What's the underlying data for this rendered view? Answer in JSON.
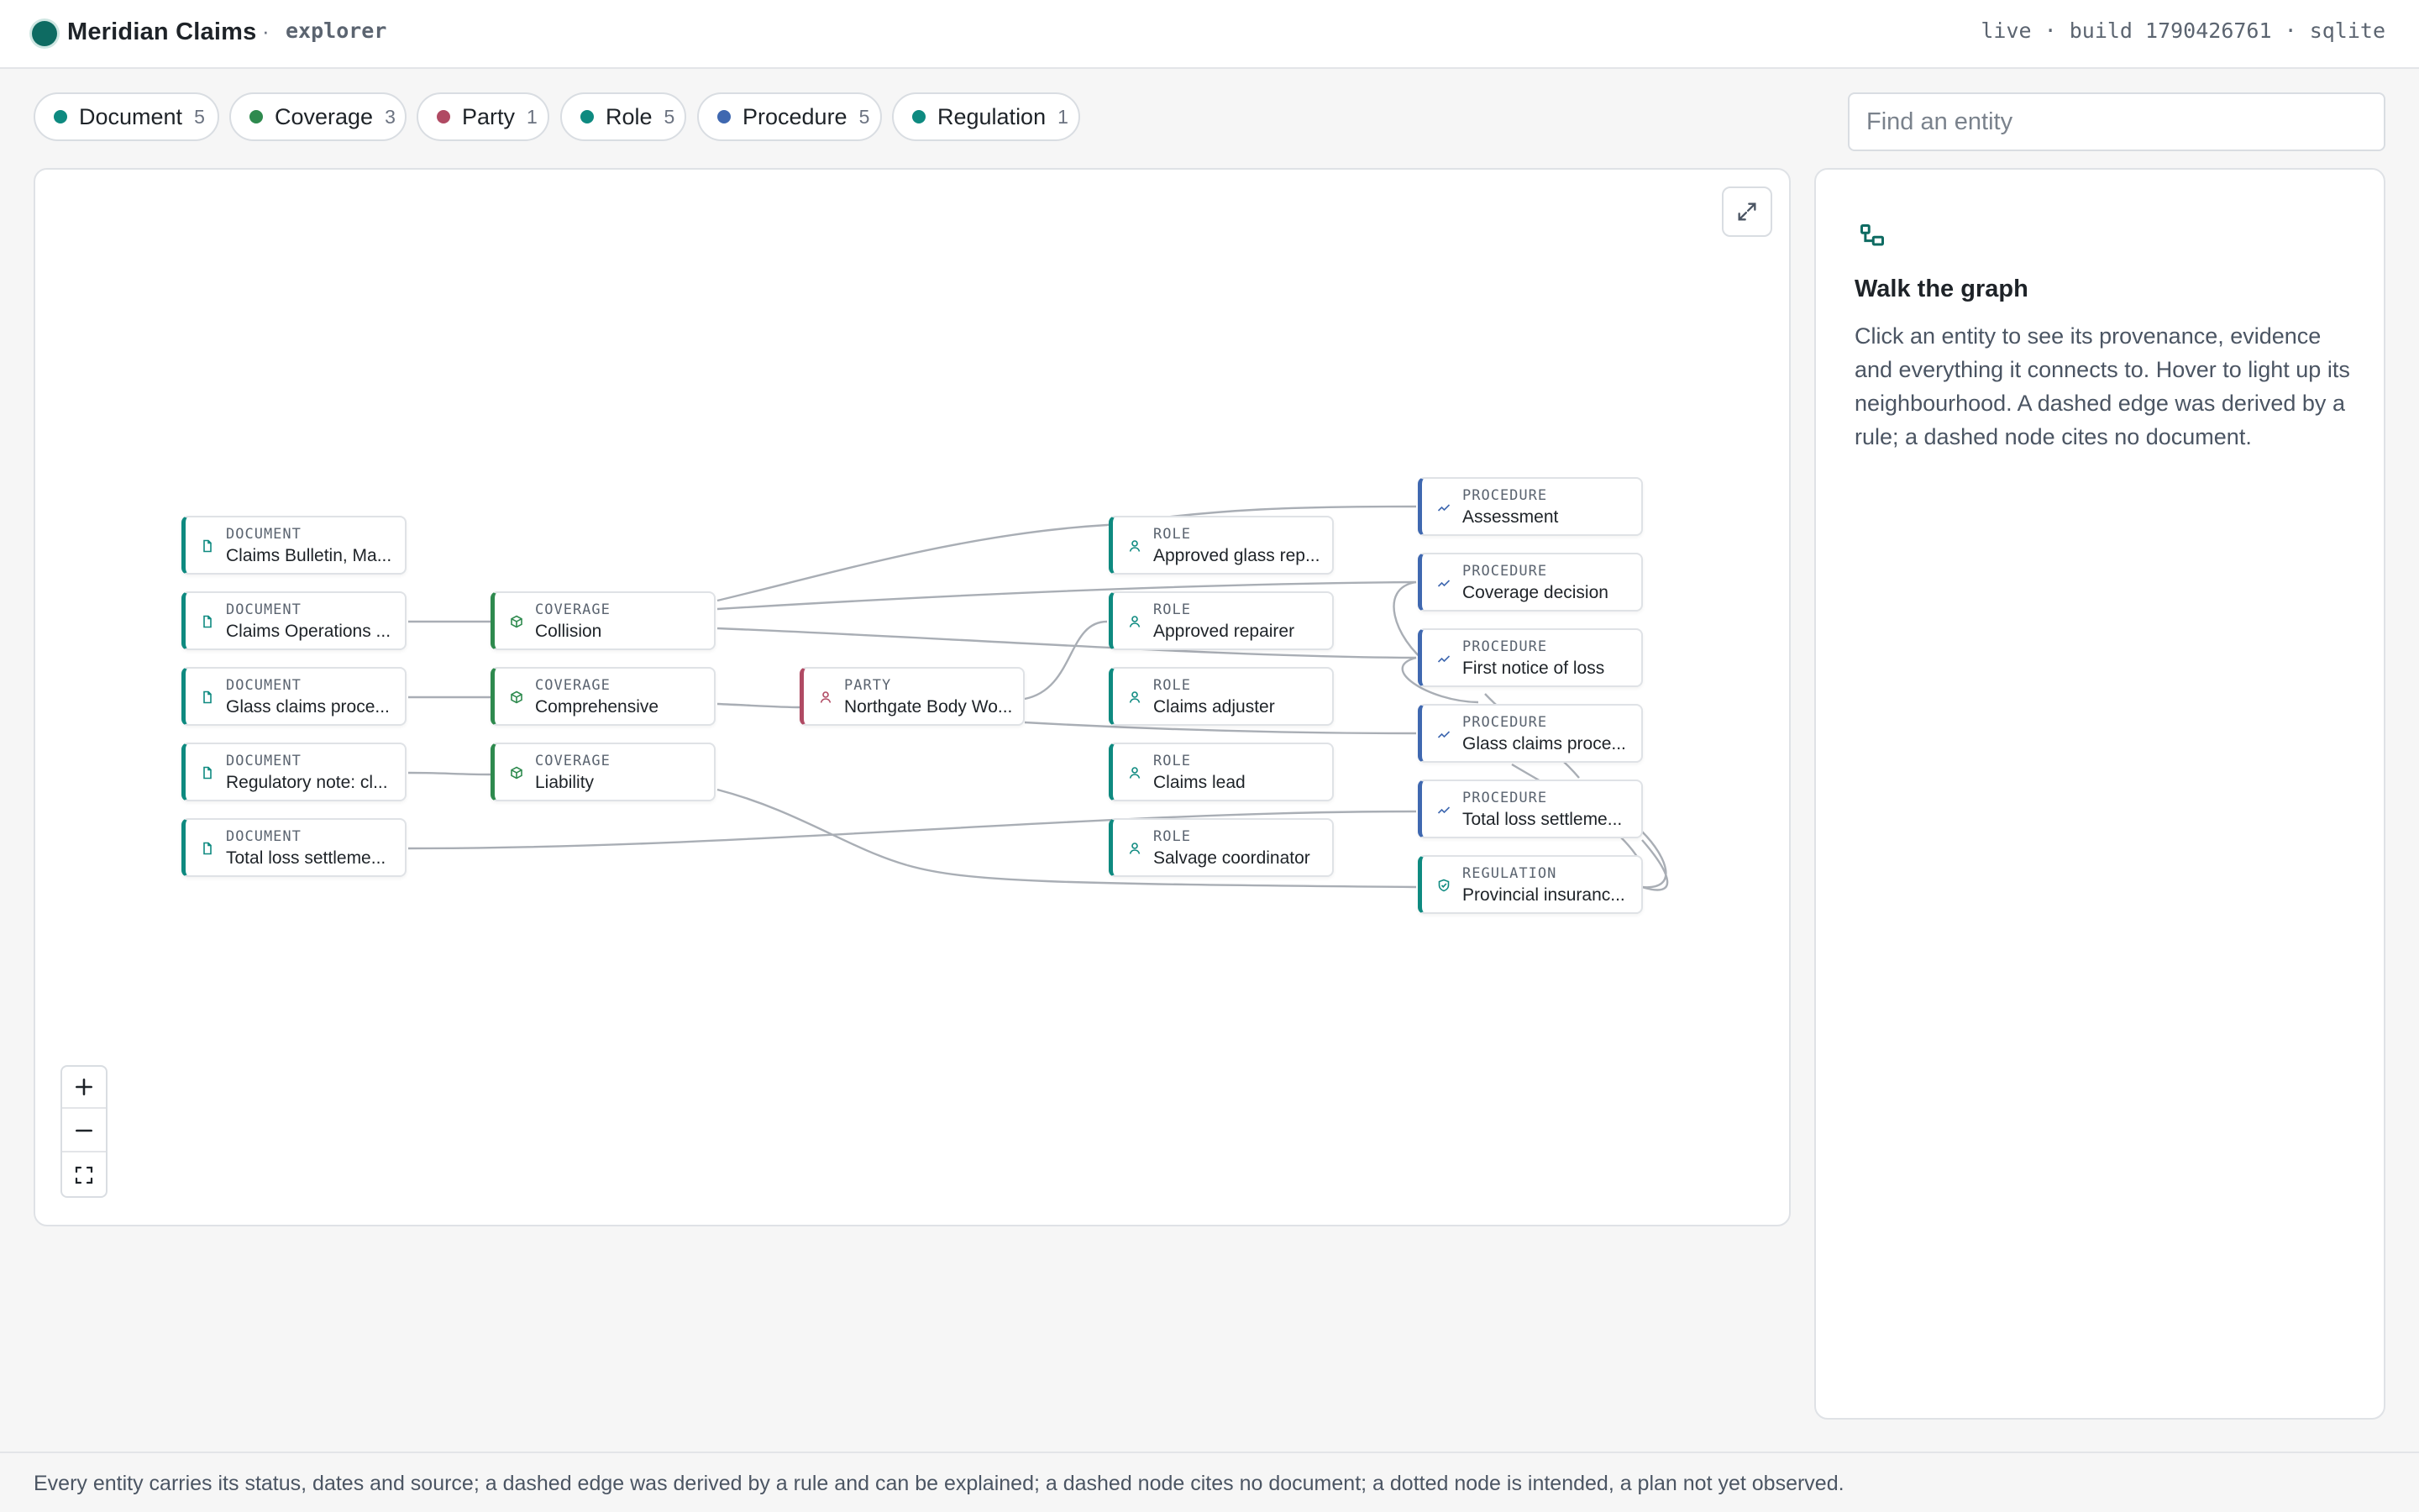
{
  "header": {
    "app_name": "Meridian Claims",
    "separator": "·",
    "section": "explorer",
    "build_info": "live · build 1790426761 · sqlite"
  },
  "filters": [
    {
      "label": "Document",
      "count": "5",
      "color": "#0e8a80"
    },
    {
      "label": "Coverage",
      "count": "3",
      "color": "#2e8a4e"
    },
    {
      "label": "Party",
      "count": "1",
      "color": "#b04a63"
    },
    {
      "label": "Role",
      "count": "5",
      "color": "#0e8a80"
    },
    {
      "label": "Procedure",
      "count": "5",
      "color": "#3f68b0"
    },
    {
      "label": "Regulation",
      "count": "1",
      "color": "#0e8a80"
    }
  ],
  "search": {
    "placeholder": "Find an entity"
  },
  "graph": {
    "nodes": [
      {
        "type": "DOCUMENT",
        "name": "Claims Bulletin, Ma..."
      },
      {
        "type": "DOCUMENT",
        "name": "Claims Operations ..."
      },
      {
        "type": "DOCUMENT",
        "name": "Glass claims proce..."
      },
      {
        "type": "DOCUMENT",
        "name": "Regulatory note: cl..."
      },
      {
        "type": "DOCUMENT",
        "name": "Total loss settleme..."
      },
      {
        "type": "COVERAGE",
        "name": "Collision"
      },
      {
        "type": "COVERAGE",
        "name": "Comprehensive"
      },
      {
        "type": "COVERAGE",
        "name": "Liability"
      },
      {
        "type": "PARTY",
        "name": "Northgate Body Wo..."
      },
      {
        "type": "ROLE",
        "name": "Approved glass rep..."
      },
      {
        "type": "ROLE",
        "name": "Approved repairer"
      },
      {
        "type": "ROLE",
        "name": "Claims adjuster"
      },
      {
        "type": "ROLE",
        "name": "Claims lead"
      },
      {
        "type": "ROLE",
        "name": "Salvage coordinator"
      },
      {
        "type": "PROCEDURE",
        "name": "Assessment"
      },
      {
        "type": "PROCEDURE",
        "name": "Coverage decision"
      },
      {
        "type": "PROCEDURE",
        "name": "First notice of loss"
      },
      {
        "type": "PROCEDURE",
        "name": "Glass claims proce..."
      },
      {
        "type": "PROCEDURE",
        "name": "Total loss settleme..."
      },
      {
        "type": "REGULATION",
        "name": "Provincial insuranc..."
      }
    ]
  },
  "panel": {
    "title": "Walk the graph",
    "body": "Click an entity to see its provenance, evidence and everything it connects to. Hover to light up its neighbourhood. A dashed edge was derived by a rule; a dashed node cites no document."
  },
  "footer": {
    "text": "Every entity carries its status, dates and source; a dashed edge was derived by a rule and can be explained; a dashed node cites no document; a dotted node is intended, a plan not yet observed."
  }
}
